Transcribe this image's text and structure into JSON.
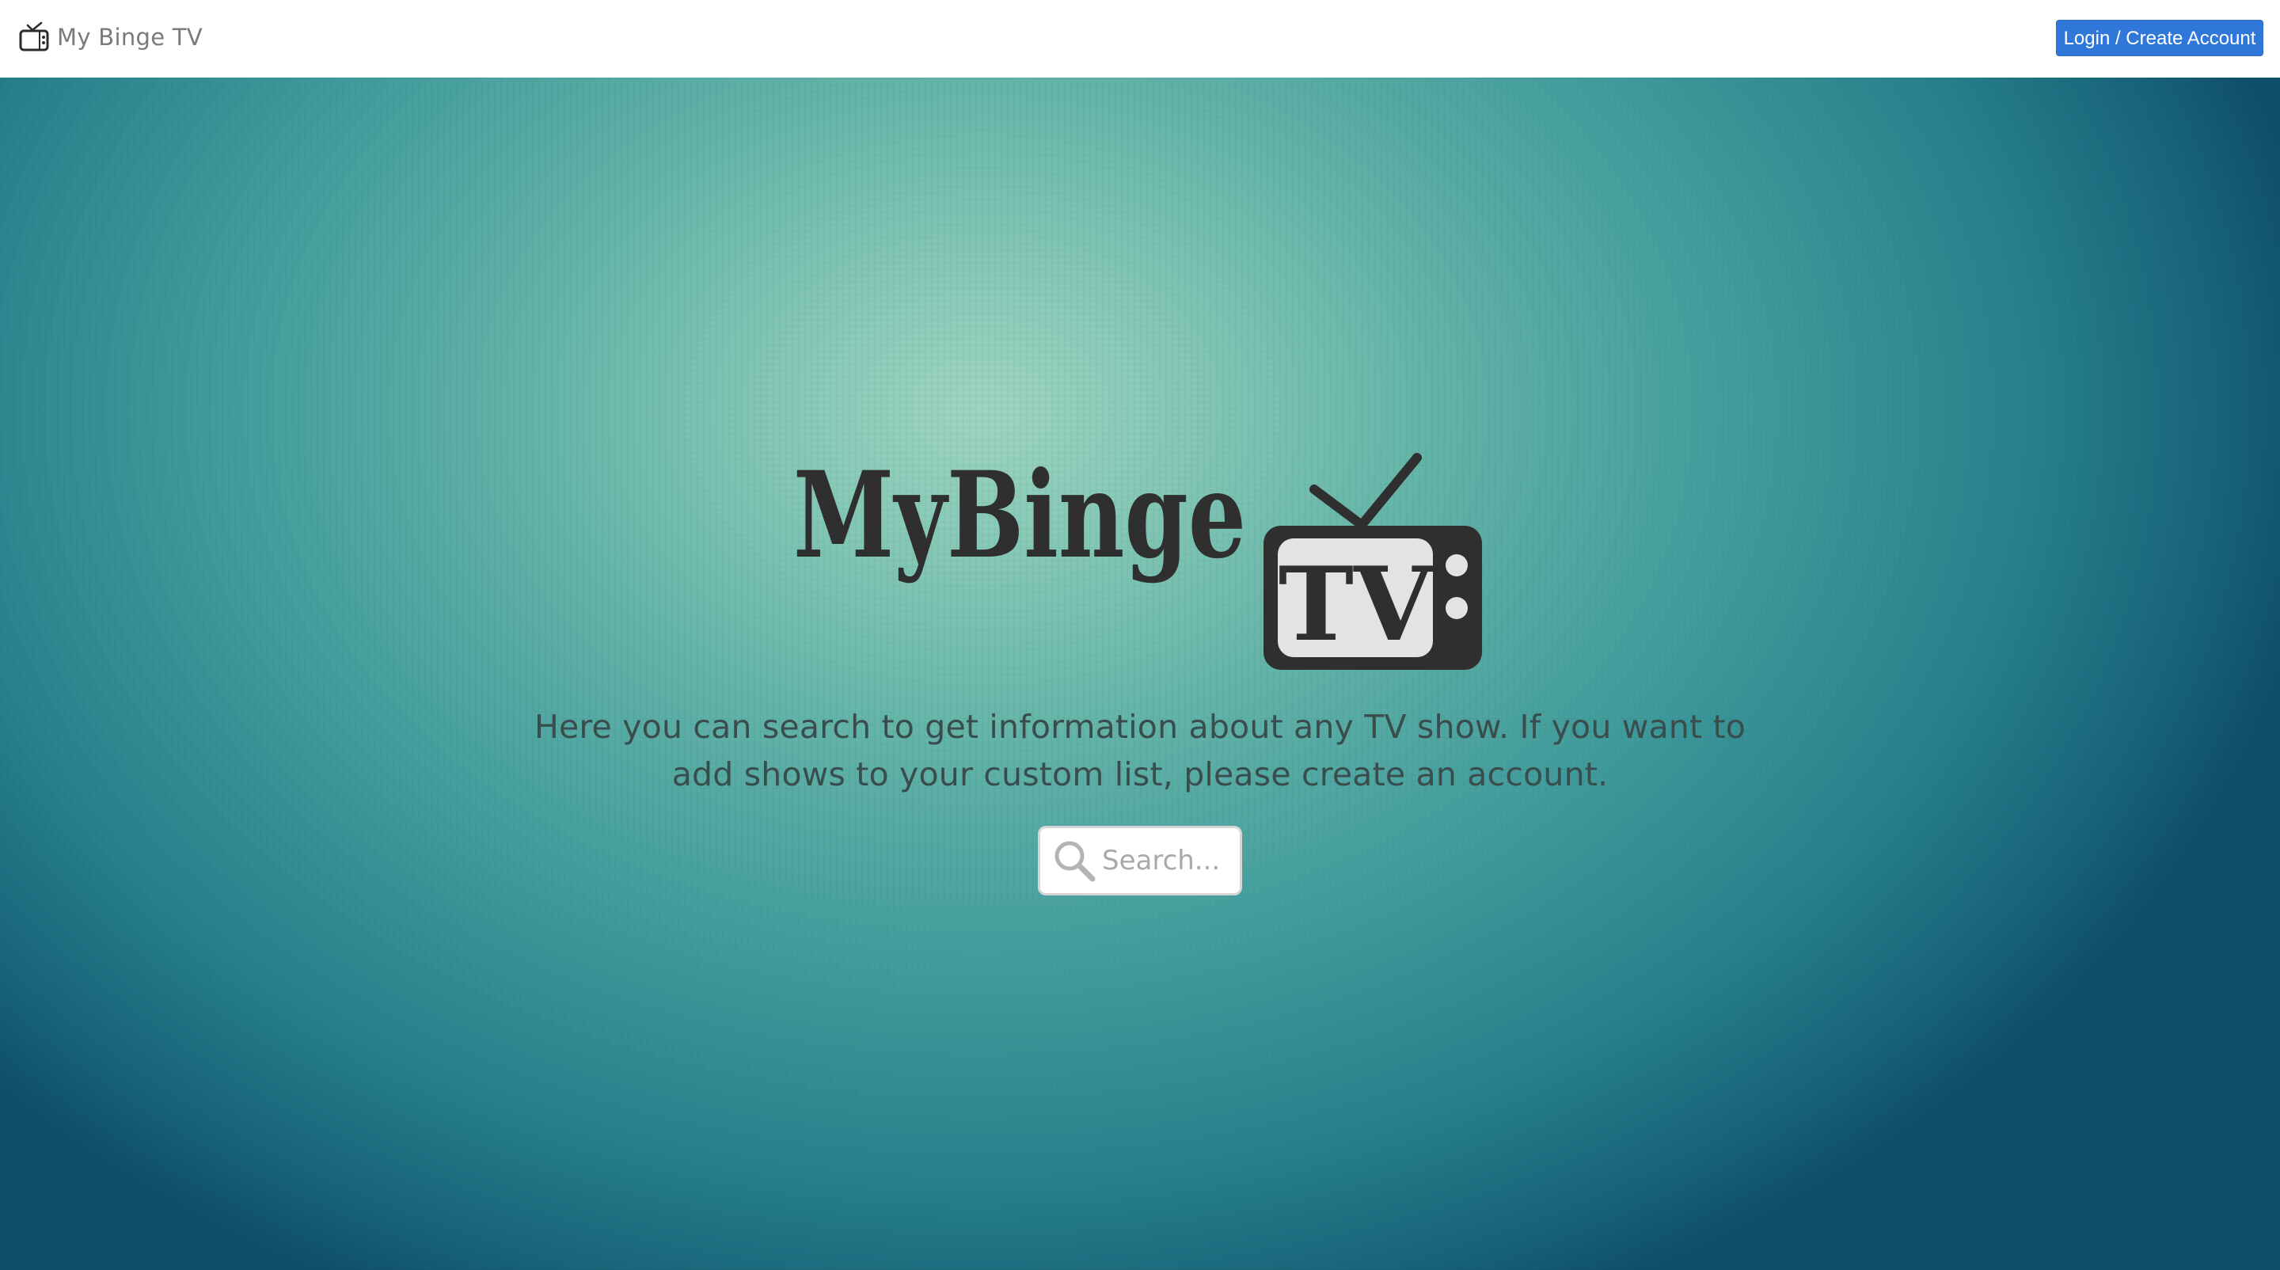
{
  "navbar": {
    "brand_icon": "tv-icon",
    "brand_label": "My Binge TV",
    "login_label": "Login / Create Account",
    "login_color": "#2f78da"
  },
  "hero": {
    "logo_icon": "mybinge-tv-logo",
    "logo_word": "MyBinge",
    "logo_tv": "TV",
    "description": "Here you can search to get information about any TV show. If you want to add shows to your custom list, please create an account.",
    "gradient_center_color": "#9ed3c1",
    "gradient_edge_color": "#0f4f68"
  },
  "search": {
    "icon": "search-icon",
    "placeholder": "Search...",
    "value": ""
  }
}
